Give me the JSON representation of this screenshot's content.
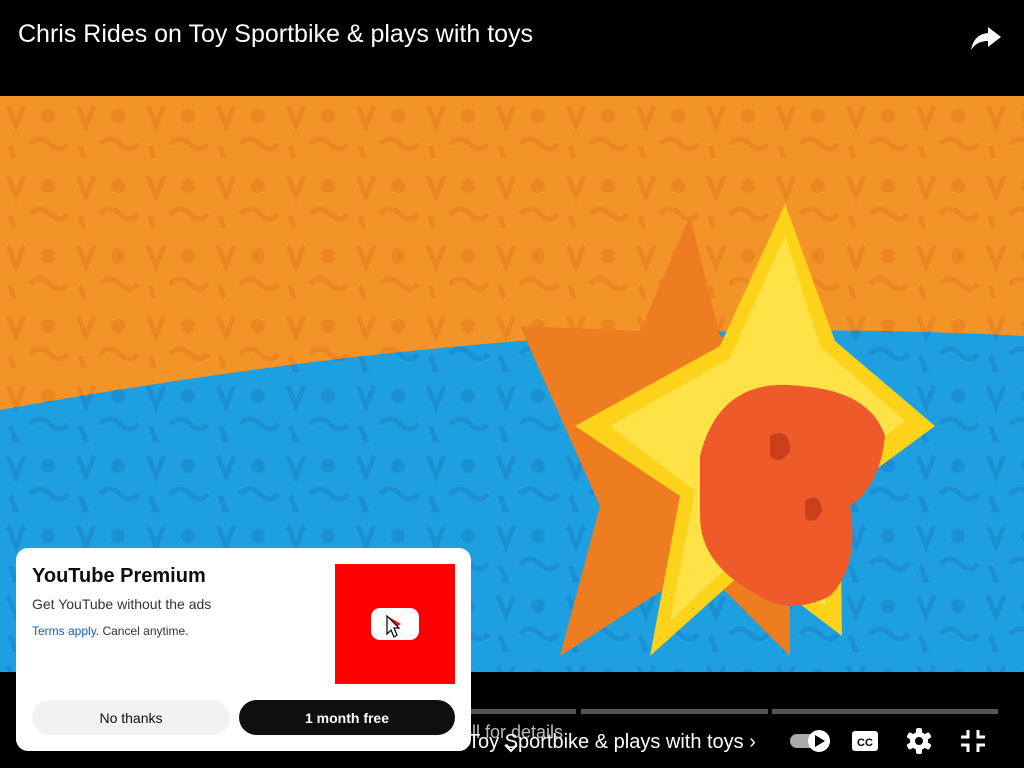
{
  "video": {
    "title": "Chris Rides on Toy Sportbike & plays with toys"
  },
  "player": {
    "chapter_hint": "oll for details",
    "chapter_title": "Toy Sportbike & plays with toys",
    "chapter_chevron": "›"
  },
  "icons": {
    "share": "share-icon",
    "autoplay": "autoplay-toggle-icon",
    "captions": "captions-icon",
    "settings": "gear-icon",
    "fullscreen_exit": "exit-fullscreen-icon",
    "chevron_down": "chevron-down-icon"
  },
  "promo": {
    "title": "YouTube Premium",
    "subtitle": "Get YouTube without the ads",
    "terms_link": "Terms apply",
    "terms_rest": ". Cancel anytime.",
    "no_thanks": "No thanks",
    "cta": "1 month free"
  },
  "colors": {
    "brand_red": "#ff0000",
    "link_blue": "#065fd4",
    "bg_orange": "#f39428",
    "bg_blue": "#1e9fe0",
    "star_yellow": "#fdd21b",
    "mouth_red": "#ef5a2a"
  }
}
